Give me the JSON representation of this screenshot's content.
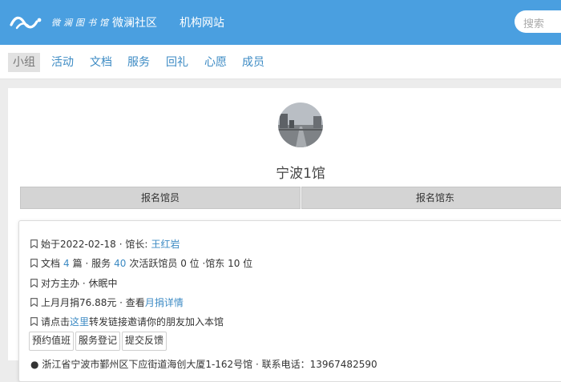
{
  "header": {
    "logo_text": "微澜图书馆",
    "nav": [
      "微澜社区",
      "机构网站"
    ],
    "search_placeholder": "搜索"
  },
  "tabs": [
    {
      "label": "小组",
      "active": true
    },
    {
      "label": "活动",
      "active": false
    },
    {
      "label": "文档",
      "active": false
    },
    {
      "label": "服务",
      "active": false
    },
    {
      "label": "回礼",
      "active": false
    },
    {
      "label": "心愿",
      "active": false
    },
    {
      "label": "成员",
      "active": false
    }
  ],
  "group": {
    "name": "宁波1馆",
    "buttons": [
      "报名馆员",
      "报名馆东"
    ]
  },
  "info": {
    "start_prefix": "始于",
    "start_date": "2022-02-18",
    "leader_label": "· 馆长:",
    "leader_name": "王红岩",
    "docs_label": "文档",
    "docs_count": "4",
    "docs_unit": "篇 · 服务",
    "service_count": "40",
    "service_suffix": "次活跃馆员 0 位 ·馆东 10 位",
    "status": "对方主办 · 休眠中",
    "donation_text": "上月月捐76.88元 · 查看",
    "donation_link": "月捐详情",
    "invite_prefix": "请点击",
    "invite_link": "这里",
    "invite_suffix": "转发链接邀请你的朋友加入本馆",
    "actions": [
      "预约值班",
      "服务登记",
      "提交反馈"
    ],
    "address_partial": "浙江省宁波市鄞州区下应街道海创大厦1-162号馆 · 联系电话：13967482590"
  }
}
